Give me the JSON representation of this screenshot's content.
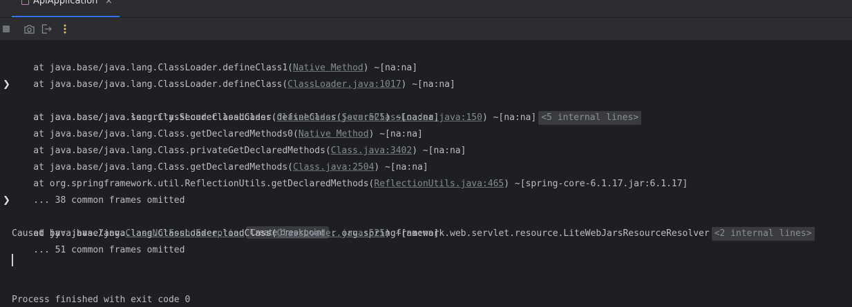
{
  "tab": {
    "label": "ApiApplication",
    "close": "×"
  },
  "toolbar": {
    "buttons": [
      "stop-icon",
      "camera-icon",
      "exit-icon",
      "more-icon"
    ]
  },
  "console": {
    "lines": [
      {
        "pre": "    at java.base/java.lang.ClassLoader.defineClass1(",
        "link": "Native Method",
        "post": ") ~[na:na]"
      },
      {
        "pre": "    at java.base/java.lang.ClassLoader.defineClass(",
        "link": "ClassLoader.java:1017",
        "post": ") ~[na:na]"
      },
      {
        "pre": "    at java.base/java.security.SecureClassLoader.defineClass(",
        "link": "SecureClassLoader.java:150",
        "post": ") ~[na:na]",
        "fold": "<5 internal lines>"
      },
      {
        "pre": "    at java.base/java.lang.ClassLoader.loadClass(",
        "link": "ClassLoader.java:525",
        "post": ") ~[na:na]"
      },
      {
        "pre": "    at java.base/java.lang.Class.getDeclaredMethods0(",
        "link": "Native Method",
        "post": ") ~[na:na]"
      },
      {
        "pre": "    at java.base/java.lang.Class.privateGetDeclaredMethods(",
        "link": "Class.java:3402",
        "post": ") ~[na:na]"
      },
      {
        "pre": "    at java.base/java.lang.Class.getDeclaredMethods(",
        "link": "Class.java:2504",
        "post": ") ~[na:na]"
      },
      {
        "pre": "    at org.springframework.util.ReflectionUtils.getDeclaredMethods(",
        "link": "ReflectionUtils.java:465",
        "post": ") ~[spring-core-6.1.17.jar:6.1.17]"
      },
      {
        "text": "    ... 38 common frames omitted"
      },
      {
        "caused_pre": "Caused by: java.lang.",
        "caused_link": "ClassNotFoundException",
        "breakpoint": "Create breakpoint",
        "caused_post": ": org.springframework.web.servlet.resource.LiteWebJarsResourceResolver",
        "fold": "<2 internal lines>"
      },
      {
        "pre": "    at java.base/java.lang.ClassLoader.loadClass(",
        "link": "ClassLoader.java:525",
        "post": ") ~[na:na]"
      },
      {
        "text": "    ... 51 common frames omitted"
      },
      {
        "text": "Process finished with exit code 0"
      }
    ]
  }
}
